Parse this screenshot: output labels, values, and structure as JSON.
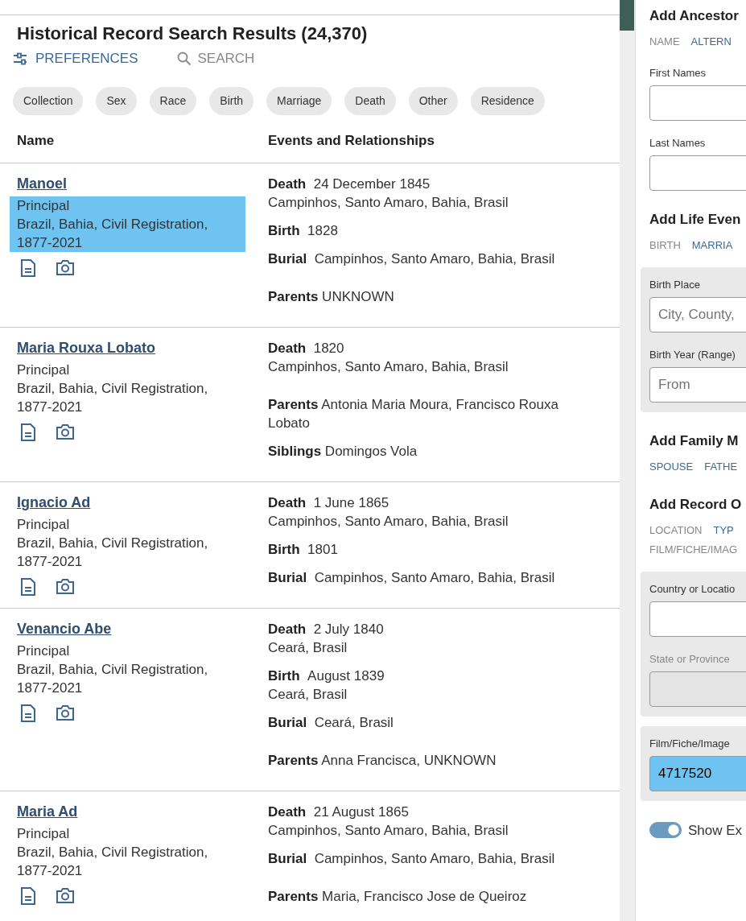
{
  "header": {
    "title": "Historical Record Search Results (24,370)",
    "actions": [
      {
        "label": "PREFERENCES",
        "kind": "preferences"
      },
      {
        "label": "SEARCH",
        "kind": "search"
      }
    ],
    "filters": [
      "Collection",
      "Sex",
      "Race",
      "Birth",
      "Marriage",
      "Death",
      "Other",
      "Residence"
    ]
  },
  "table": {
    "columns": [
      "Name",
      "Events and Relationships"
    ],
    "rows": [
      {
        "name": "Manoel",
        "role": "Principal",
        "collection": "Brazil, Bahia, Civil Registration, 1877-2021",
        "highlighted": true,
        "events": [
          {
            "label": "Death",
            "value": "24 December 1845",
            "place": "Campinhos, Santo Amaro, Bahia, Brasil"
          },
          {
            "label": "Birth",
            "value": "1828"
          },
          {
            "label": "Burial",
            "value": "Campinhos, Santo Amaro, Bahia, Brasil"
          },
          {
            "label": "Parents",
            "value": "UNKNOWN",
            "kind": "relation"
          }
        ]
      },
      {
        "name": "Maria Rouxa Lobato",
        "role": "Principal",
        "collection": "Brazil, Bahia, Civil Registration, 1877-2021",
        "highlighted": false,
        "events": [
          {
            "label": "Death",
            "value": "1820",
            "place": "Campinhos, Santo Amaro, Bahia, Brasil"
          },
          {
            "label": "Parents",
            "value": "Antonia Maria Moura, Francisco Rouxa Lobato",
            "kind": "relation"
          },
          {
            "label": "Siblings",
            "value": "Domingos Vola",
            "kind": "relation"
          }
        ]
      },
      {
        "name": "Ignacio Ad",
        "role": "Principal",
        "collection": "Brazil, Bahia, Civil Registration, 1877-2021",
        "highlighted": false,
        "events": [
          {
            "label": "Death",
            "value": "1 June 1865",
            "place": "Campinhos, Santo Amaro, Bahia, Brasil"
          },
          {
            "label": "Birth",
            "value": "1801"
          },
          {
            "label": "Burial",
            "value": "Campinhos, Santo Amaro, Bahia, Brasil"
          }
        ]
      },
      {
        "name": "Venancio Abe",
        "role": "Principal",
        "collection": "Brazil, Bahia, Civil Registration, 1877-2021",
        "highlighted": false,
        "events": [
          {
            "label": "Death",
            "value": "2 July 1840",
            "place": "Ceará, Brasil"
          },
          {
            "label": "Birth",
            "value": "August 1839",
            "place": "Ceará, Brasil"
          },
          {
            "label": "Burial",
            "value": "Ceará, Brasil"
          },
          {
            "label": "Parents",
            "value": "Anna Francisca, UNKNOWN",
            "kind": "relation"
          }
        ]
      },
      {
        "name": "Maria Ad",
        "role": "Principal",
        "collection": "Brazil, Bahia, Civil Registration, 1877-2021",
        "highlighted": false,
        "events": [
          {
            "label": "Death",
            "value": "21 August 1865",
            "place": "Campinhos, Santo Amaro, Bahia, Brasil"
          },
          {
            "label": "Burial",
            "value": "Campinhos, Santo Amaro, Bahia, Brasil"
          },
          {
            "label": "Parents",
            "value": "Maria, Francisco Jose de Queiroz",
            "kind": "relation"
          }
        ]
      }
    ]
  },
  "sidebar": {
    "sections": [
      {
        "title": "Add Ancestor",
        "tabs": [
          {
            "label": "NAME",
            "selected": true
          },
          {
            "label": "ALTERN",
            "selected": false
          }
        ],
        "groups": [
          {
            "boxed": false,
            "fields": [
              {
                "label": "First Names"
              },
              {
                "label": "Last Names"
              }
            ]
          }
        ]
      },
      {
        "title": "Add Life Even",
        "tabs": [
          {
            "label": "BIRTH",
            "selected": true
          },
          {
            "label": "MARRIA",
            "selected": false
          }
        ],
        "groups": [
          {
            "boxed": true,
            "fields": [
              {
                "label": "Birth Place",
                "placeholder": "City, County,"
              },
              {
                "label": "Birth Year (Range)",
                "placeholder": "From"
              }
            ]
          }
        ]
      },
      {
        "title": "Add Family M",
        "tabs": [
          {
            "label": "SPOUSE",
            "selected": false
          },
          {
            "label": "FATHE",
            "selected": false
          }
        ]
      },
      {
        "title": "Add Record O",
        "tabs": [
          {
            "label": "LOCATION",
            "selected": true
          },
          {
            "label": "TYP",
            "selected": false
          },
          {
            "label": "FILM/FICHE/IMAG",
            "selected": true
          }
        ],
        "groups": [
          {
            "boxed": true,
            "fields": [
              {
                "label": "Country or Locatio"
              },
              {
                "label": "State or Province",
                "disabled": true
              }
            ]
          },
          {
            "boxed": true,
            "fields": [
              {
                "label": "Film/Fiche/Image",
                "value": "4717520",
                "highlighted": true
              }
            ]
          }
        ]
      }
    ],
    "toggle": {
      "label": "Show Ex",
      "on": true
    }
  }
}
